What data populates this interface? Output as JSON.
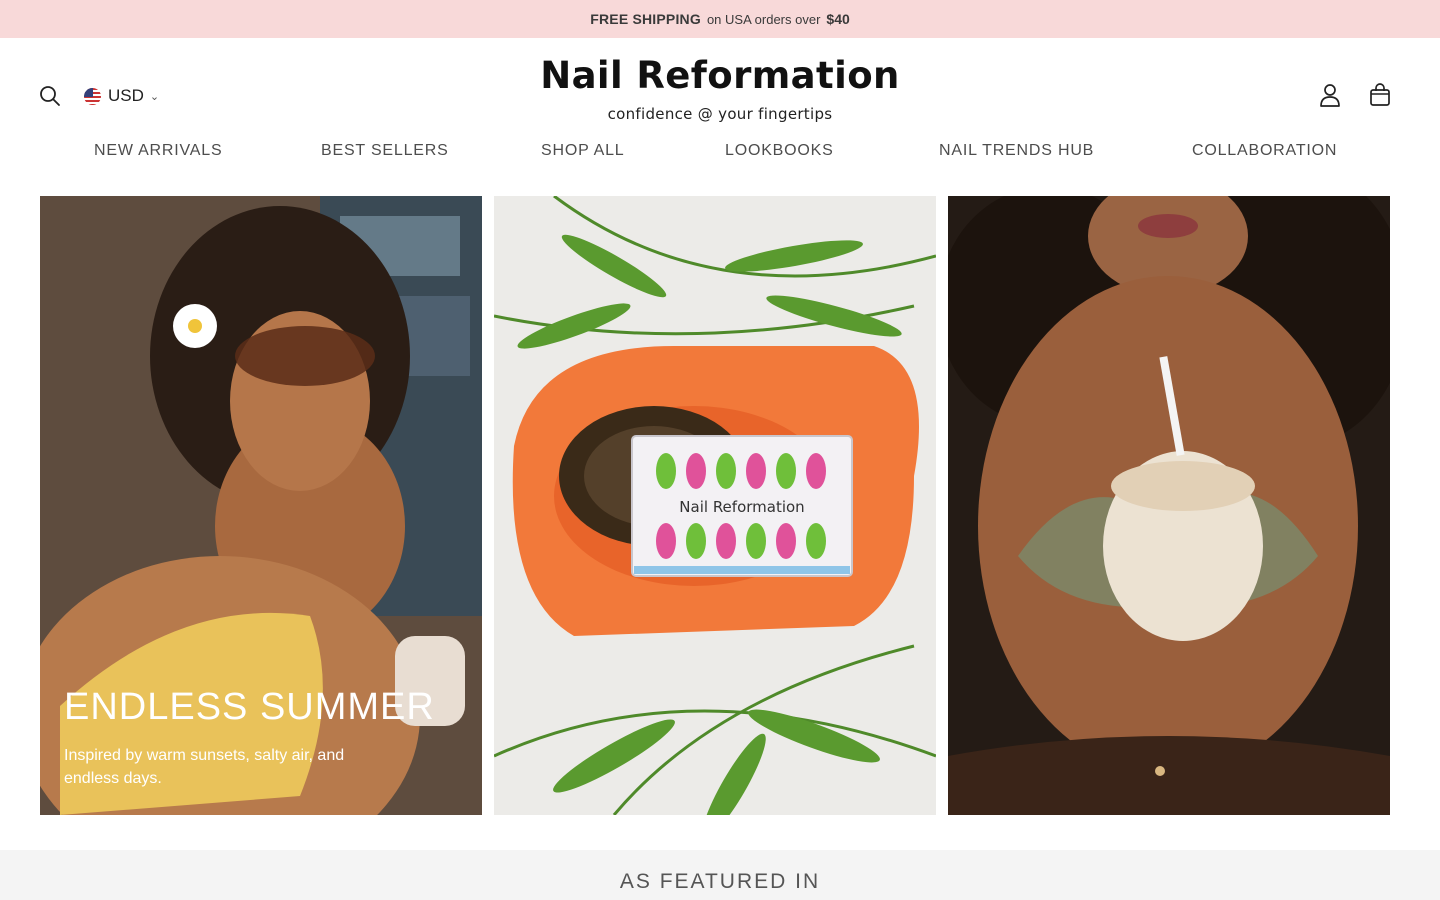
{
  "announcement": {
    "bold": "FREE SHIPPING",
    "normal": "on USA orders over",
    "amount": "$40"
  },
  "header": {
    "currency": "USD",
    "logo": "Nail Reformation",
    "tagline": "confidence @ your fingertips"
  },
  "nav": {
    "items": [
      "NEW ARRIVALS",
      "BEST SELLERS",
      "SHOP ALL",
      "LOOKBOOKS",
      "NAIL TRENDS HUB",
      "COLLABORATION"
    ]
  },
  "hero": {
    "title": "ENDLESS SUMMER",
    "subtitle": "Inspired by warm sunsets, salty air, and endless days.",
    "product_box_logo": "Nail Reformation"
  },
  "featured": {
    "title": "AS FEATURED IN"
  },
  "colors": {
    "announcement_bg": "#f8d9d9",
    "featured_bg": "#f4f4f4",
    "text": "#222222",
    "nav_text": "#4d4d4d"
  },
  "icons": [
    "search-icon",
    "flag-us-icon",
    "chevron-down-icon",
    "account-icon",
    "cart-icon"
  ]
}
